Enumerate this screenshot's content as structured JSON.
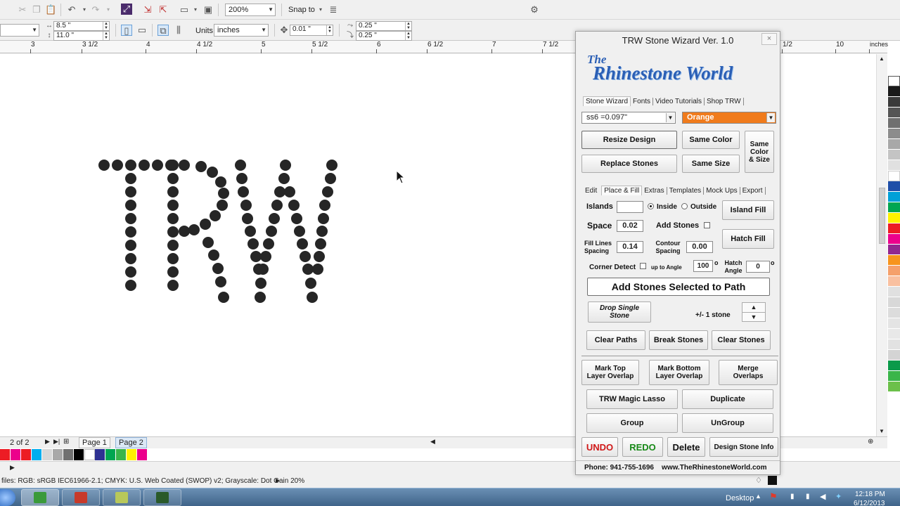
{
  "toolbar": {
    "zoom": "200%",
    "snap_to": "Snap to",
    "width": "8.5 \"",
    "height": "11.0 \"",
    "units_label": "Units:",
    "units": "inches",
    "nudge": "0.01 \"",
    "dup_x": "0.25 \"",
    "dup_y": "0.25 \""
  },
  "ruler": {
    "ticks": [
      "3",
      "3 1/2",
      "4",
      "4 1/2",
      "5",
      "5 1/2",
      "6",
      "6 1/2",
      "7",
      "7 1/2",
      "1/2",
      "10",
      "inches"
    ]
  },
  "canvas": {
    "design_text": "TRW"
  },
  "pagebar": {
    "counter": "2 of 2",
    "page1": "Page 1",
    "page2": "Page 2"
  },
  "status": {
    "profiles": "files: RGB: sRGB IEC61966-2.1; CMYK: U.S. Web Coated (SWOP) v2; Grayscale: Dot Gain 20%"
  },
  "taskbar": {
    "desktop": "Desktop",
    "time": "12:18 PM",
    "date": "6/12/2013"
  },
  "panel": {
    "title": "TRW Stone Wizard Ver. 1.0",
    "close": "×",
    "logo_the": "The",
    "logo_name": "Rhinestone World",
    "top_tabs": [
      "Stone Wizard",
      "Fonts",
      "Video Tutorials",
      "Shop TRW"
    ],
    "stone_size": "ss6 =0.097\"",
    "color": "Orange",
    "color_hex": "#f07b1c",
    "resize_design": "Resize Design",
    "same_color": "Same Color",
    "same_color_size": "Same Color & Size",
    "replace_stones": "Replace Stones",
    "same_size": "Same Size",
    "sub_tabs": [
      "Edit",
      "Place & Fill",
      "Extras",
      "Templates",
      "Mock Ups",
      "Export"
    ],
    "islands_label": "Islands",
    "islands_value": "",
    "inside": "Inside",
    "outside": "Outside",
    "island_fill": "Island Fill",
    "space_label": "Space",
    "space_value": "0.02",
    "add_stones_label": "Add Stones",
    "fill_lines_label": "Fill Lines Spacing",
    "fill_lines_value": "0.14",
    "contour_label": "Contour Spacing",
    "contour_value": "0.00",
    "hatch_fill": "Hatch Fill",
    "corner_detect": "Corner Detect",
    "up_to_angle": "up to Angle",
    "angle_value": "100",
    "degree": "o",
    "hatch_angle_label": "Hatch Angle",
    "hatch_angle_value": "0",
    "add_stones_path": "Add Stones Selected to Path",
    "drop_single": "Drop Single Stone",
    "plus_minus": "+/- 1 stone",
    "clear_paths": "Clear Paths",
    "break_stones": "Break Stones",
    "clear_stones": "Clear Stones",
    "mark_top": "Mark Top Layer Overlap",
    "mark_bottom": "Mark Bottom Layer Overlap",
    "merge_overlaps": "Merge Overlaps",
    "magic_lasso": "TRW Magic Lasso",
    "duplicate": "Duplicate",
    "group": "Group",
    "ungroup": "UnGroup",
    "undo": "UNDO",
    "redo": "REDO",
    "delete": "Delete",
    "design_stone_info": "Design Stone Info",
    "footer": "Phone: 941-755-1696    www.TheRhinestoneWorld.com"
  }
}
